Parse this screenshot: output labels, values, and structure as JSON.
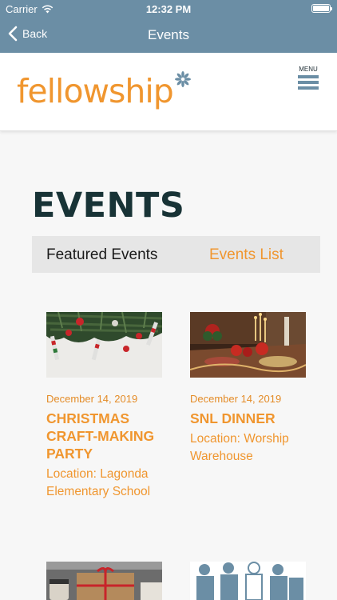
{
  "status_bar": {
    "carrier": "Carrier",
    "time": "12:32 PM"
  },
  "nav": {
    "back_label": "Back",
    "title": "Events"
  },
  "header": {
    "logo_text": "fellowship",
    "menu_label": "MENU"
  },
  "page": {
    "heading": "EVENTS"
  },
  "tabs": [
    {
      "label": "Featured Events",
      "active": true
    },
    {
      "label": "Events List",
      "active": false
    }
  ],
  "events": [
    {
      "date": "December 14, 2019",
      "title": "CHRISTMAS CRAFT-MAKING PARTY",
      "location": "Location: Lagonda Elementary School",
      "image": "christmas-garland-photo"
    },
    {
      "date": "December 14, 2019",
      "title": "SNL DINNER",
      "location": "Location: Worship Warehouse",
      "image": "holiday-table-photo"
    },
    {
      "date": "",
      "title": "",
      "location": "",
      "image": "wrapped-gift-photo"
    },
    {
      "date": "",
      "title": "",
      "location": "",
      "image": "figures-illustration"
    }
  ],
  "colors": {
    "nav_bg": "#6b8ea5",
    "accent": "#f0962f",
    "heading": "#183336",
    "tab_bg": "#e6e6e6"
  }
}
